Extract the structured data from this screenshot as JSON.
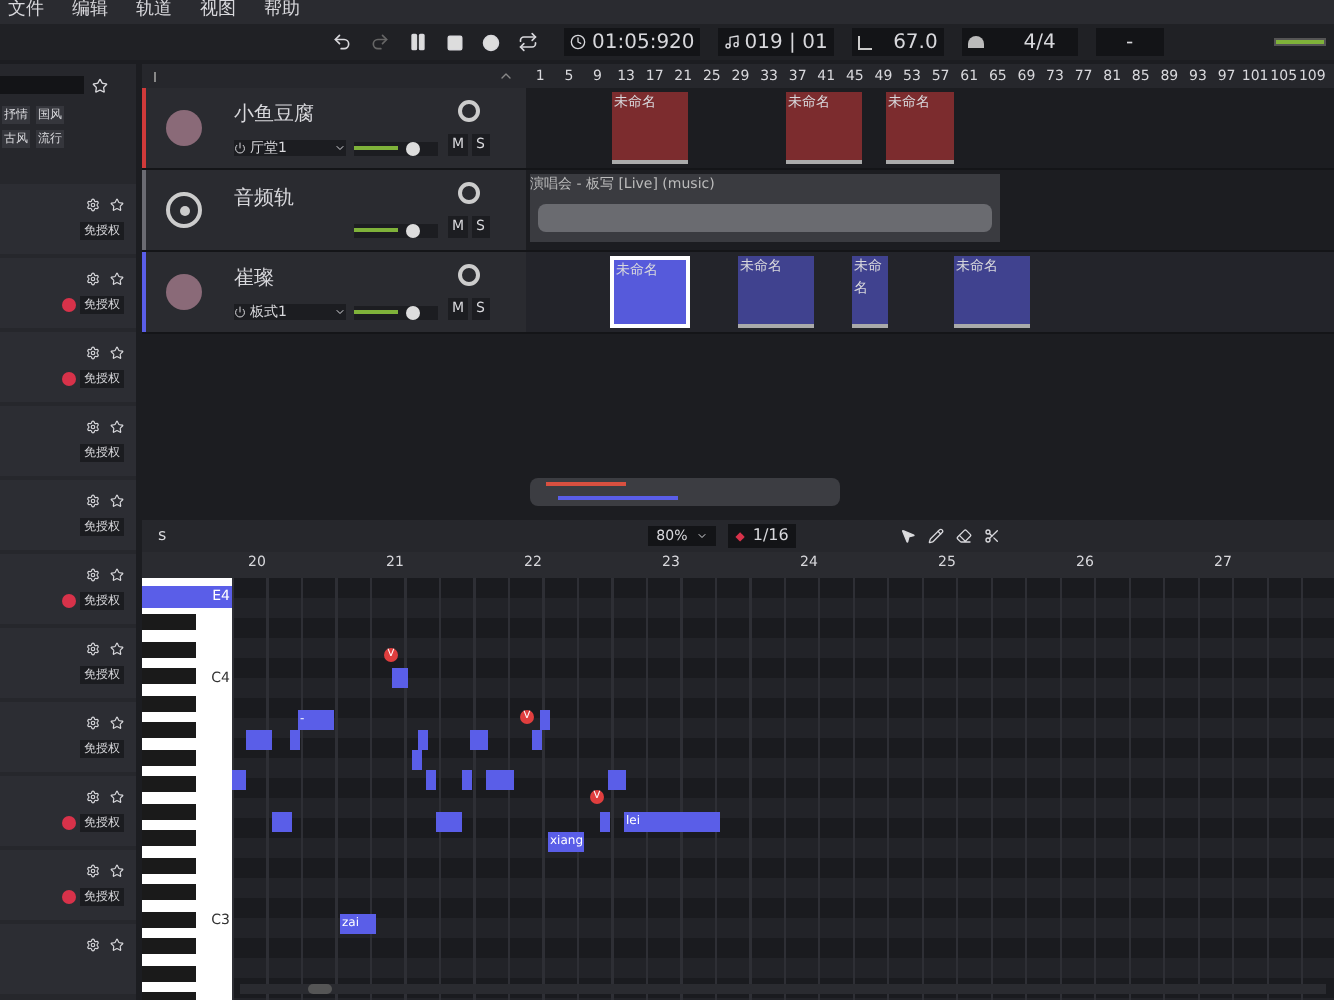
{
  "menu": [
    "文件",
    "编辑",
    "轨道",
    "视图",
    "帮助"
  ],
  "transport": {
    "time": "01:05:920",
    "position": "019 | 01",
    "tempo": "67.0",
    "meter": "4/4",
    "key": "-"
  },
  "library": {
    "tags": [
      "抒情",
      "国风",
      "古风",
      "流行"
    ],
    "items": [
      {
        "badge": "免授权",
        "flag": false
      },
      {
        "badge": "免授权",
        "flag": true
      },
      {
        "badge": "免授权",
        "flag": true
      },
      {
        "badge": "免授权",
        "flag": false
      },
      {
        "badge": "免授权",
        "flag": false
      },
      {
        "badge": "免授权",
        "flag": true
      },
      {
        "badge": "免授权",
        "flag": false
      },
      {
        "badge": "免授权",
        "flag": false
      },
      {
        "badge": "免授权",
        "flag": true
      },
      {
        "badge": "免授权",
        "flag": true
      },
      {
        "flag": false
      }
    ]
  },
  "ruler": [
    "1",
    "5",
    "9",
    "13",
    "17",
    "21",
    "25",
    "29",
    "33",
    "37",
    "41",
    "45",
    "49",
    "53",
    "57",
    "61",
    "65",
    "69",
    "73",
    "77",
    "81",
    "85",
    "89",
    "93",
    "97",
    "101",
    "105",
    "109"
  ],
  "tracks": [
    {
      "kind": "voice",
      "name": "小鱼豆腐",
      "preset": "厅堂1",
      "mute": "M",
      "solo": "S",
      "color": "#d03a3a",
      "clips": [
        {
          "name": "未命名",
          "selected": false
        },
        {
          "name": "未命名",
          "selected": false
        },
        {
          "name": "未命名",
          "selected": false
        }
      ]
    },
    {
      "kind": "audio",
      "name": "音频轨",
      "mute": "M",
      "solo": "S",
      "color": "#6b6b72",
      "clips": [
        {
          "name": "演唱会 - 板写 [Live] (music)"
        }
      ]
    },
    {
      "kind": "voice",
      "name": "崔璨",
      "preset": "板式1",
      "mute": "M",
      "solo": "S",
      "color": "#5a5ee8",
      "clips": [
        {
          "name": "未命名",
          "selected": true
        },
        {
          "name": "未命名",
          "selected": false
        },
        {
          "name": "未命名",
          "selected": false
        },
        {
          "name": "未命名",
          "selected": false
        }
      ]
    }
  ],
  "piano_roll": {
    "label": "s",
    "zoom": "80%",
    "quantize_icon": "◆",
    "quantize": "1/16",
    "bars": [
      "20",
      "21",
      "22",
      "23",
      "24",
      "25",
      "26",
      "27"
    ],
    "keys": [
      "E4",
      "C4",
      "C3"
    ],
    "notes": [
      {
        "lyric": "-"
      },
      {
        "lyric": "xiang"
      },
      {
        "lyric": "lei"
      },
      {
        "lyric": "zai"
      }
    ],
    "markers": [
      "V",
      "V",
      "V"
    ]
  }
}
